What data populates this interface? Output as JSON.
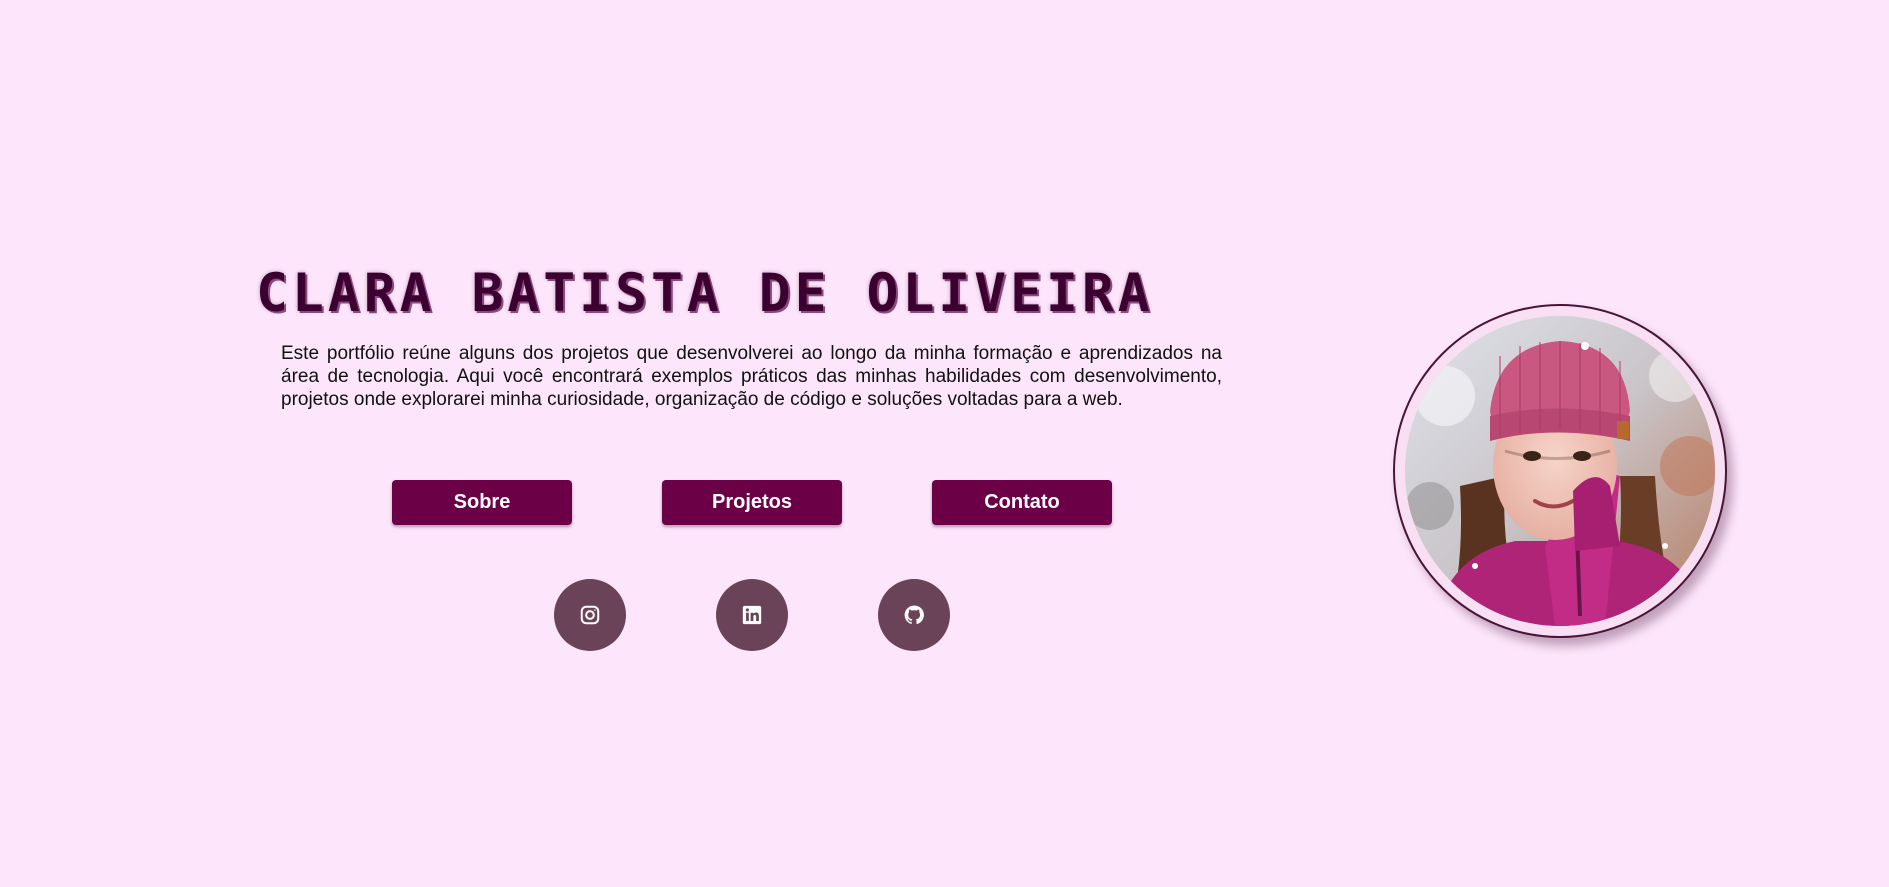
{
  "hero": {
    "title": "CLARA BATISTA DE OLIVEIRA",
    "description": "Este portfólio reúne alguns dos projetos que desenvolverei ao longo da minha formação e aprendizados na área de tecnologia. Aqui você encontrará exemplos práticos das minhas habilidades com desenvolvimento, projetos onde explorarei minha curiosidade, organização de código e soluções voltadas para a web."
  },
  "nav": {
    "buttons": [
      {
        "label": "Sobre"
      },
      {
        "label": "Projetos"
      },
      {
        "label": "Contato"
      }
    ]
  },
  "social": {
    "links": [
      {
        "icon": "instagram-icon"
      },
      {
        "icon": "linkedin-icon"
      },
      {
        "icon": "github-icon"
      }
    ]
  },
  "colors": {
    "background": "#fde6fb",
    "accent": "#6b0047",
    "social_bg": "#6a4358",
    "title": "#3b0030"
  }
}
